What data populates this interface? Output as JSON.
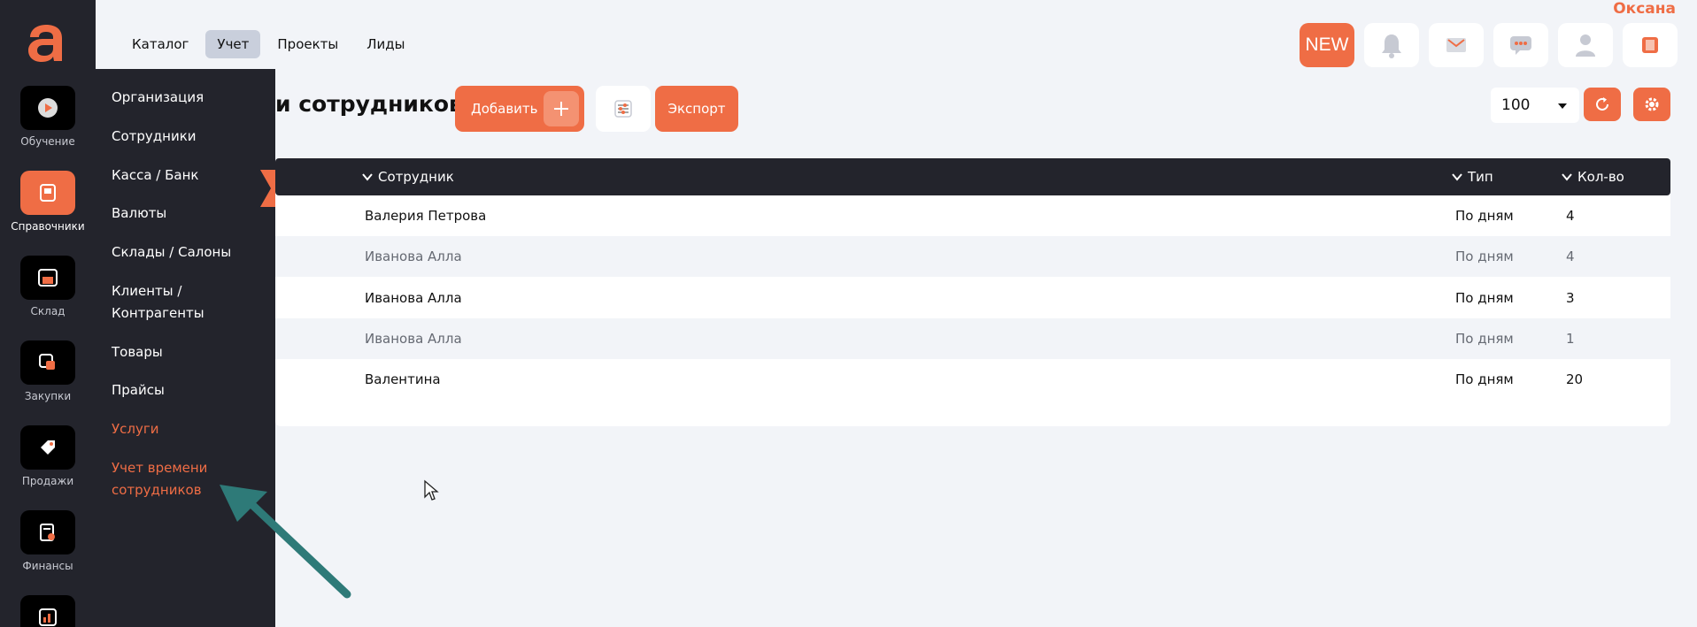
{
  "user": {
    "name": "Оксана"
  },
  "nav": {
    "tabs": [
      {
        "label": "Каталог"
      },
      {
        "label": "Учет"
      },
      {
        "label": "Проекты"
      },
      {
        "label": "Лиды"
      }
    ],
    "active_tab": "Учет"
  },
  "toolbar": {
    "new_label": "NEW"
  },
  "rail": {
    "items": [
      {
        "label": "Обучение",
        "icon": "play-icon"
      },
      {
        "label": "Справочники",
        "icon": "book-icon"
      },
      {
        "label": "Склад",
        "icon": "warehouse-icon"
      },
      {
        "label": "Закупки",
        "icon": "purchase-icon"
      },
      {
        "label": "Продажи",
        "icon": "tag-icon"
      },
      {
        "label": "Финансы",
        "icon": "finance-icon"
      }
    ],
    "active": "Справочники"
  },
  "submenu": {
    "items": [
      {
        "label": "Организация"
      },
      {
        "label": "Сотрудники"
      },
      {
        "label": "Касса / Банк"
      },
      {
        "label": "Валюты"
      },
      {
        "label": "Склады / Салоны"
      },
      {
        "label": "Клиенты / Контрагенты"
      },
      {
        "label": "Товары"
      },
      {
        "label": "Прайсы"
      },
      {
        "label": "Услуги"
      },
      {
        "label": "Учет времени сотрудников"
      }
    ],
    "active": "Учет времени сотрудников"
  },
  "page": {
    "title_visible": "и сотрудников",
    "add_label": "Добавить",
    "export_label": "Экспорт",
    "per_page": "100"
  },
  "table": {
    "columns": [
      {
        "label": "Сотрудник"
      },
      {
        "label": "Тип"
      },
      {
        "label": "Кол-во"
      }
    ],
    "rows": [
      {
        "employee": "Валерия Петрова",
        "type": "По дням",
        "qty": "4"
      },
      {
        "employee": "Иванова Алла",
        "type": "По дням",
        "qty": "4"
      },
      {
        "employee": "Иванова Алла",
        "type": "По дням",
        "qty": "3"
      },
      {
        "employee": "Иванова Алла",
        "type": "По дням",
        "qty": "1"
      },
      {
        "employee": "Валентина",
        "type": "По дням",
        "qty": "20"
      }
    ]
  },
  "colors": {
    "accent": "#ef6d45",
    "dark": "#23242c",
    "bg": "#f2f4f8",
    "arrow": "#2e7a78"
  }
}
